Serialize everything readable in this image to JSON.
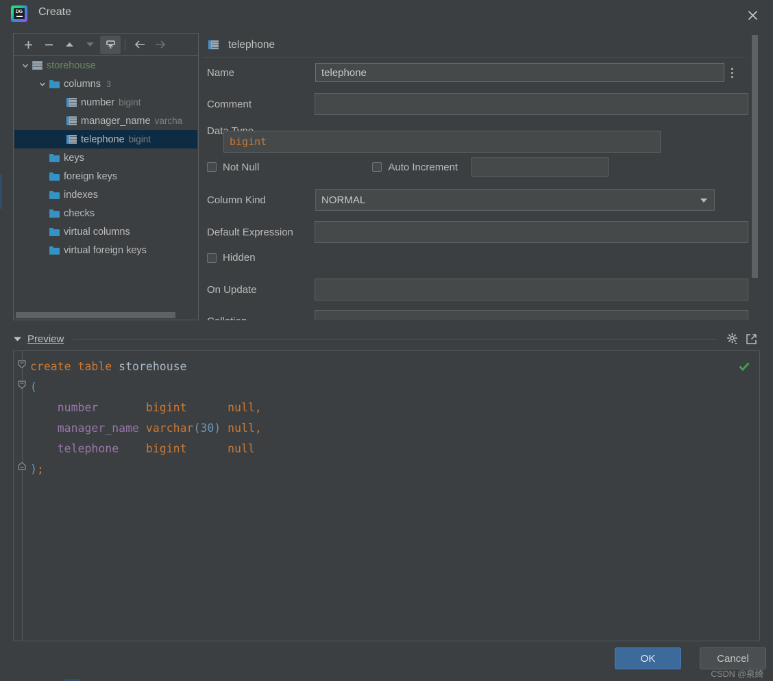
{
  "window": {
    "title": "Create",
    "logo_icon": "datagrip-logo-icon",
    "close_icon": "close-icon"
  },
  "tree_toolbar": {
    "buttons": [
      {
        "name": "add-button",
        "icon": "plus-icon",
        "enabled": true,
        "active": false
      },
      {
        "name": "remove-button",
        "icon": "minus-icon",
        "enabled": true,
        "active": false
      },
      {
        "name": "move-up-button",
        "icon": "arrow-up-icon",
        "enabled": true,
        "active": false
      },
      {
        "name": "move-down-button",
        "icon": "arrow-down-icon",
        "enabled": false,
        "active": false
      },
      {
        "name": "move-into-button",
        "icon": "upload-into-icon",
        "enabled": true,
        "active": true
      },
      {
        "name": "navigate-back-button",
        "icon": "arrow-left-icon",
        "enabled": true,
        "active": false
      },
      {
        "name": "navigate-forward-button",
        "icon": "arrow-right-icon",
        "enabled": false,
        "active": false
      }
    ]
  },
  "tree": {
    "rows": [
      {
        "label": "storehouse",
        "sub": "",
        "count": "",
        "icon": "table-icon",
        "indent": 0,
        "twisty": "expanded",
        "selected": false,
        "label_color": "green"
      },
      {
        "label": "columns",
        "sub": "",
        "count": "3",
        "icon": "folder-icon",
        "indent": 1,
        "twisty": "expanded",
        "selected": false,
        "label_color": "normal"
      },
      {
        "label": "number",
        "sub": "bigint",
        "count": "",
        "icon": "column-icon",
        "indent": 2,
        "twisty": "none",
        "selected": false,
        "label_color": "normal"
      },
      {
        "label": "manager_name",
        "sub": "varcha",
        "count": "",
        "icon": "column-icon",
        "indent": 2,
        "twisty": "none",
        "selected": false,
        "label_color": "normal"
      },
      {
        "label": "telephone",
        "sub": "bigint",
        "count": "",
        "icon": "column-icon",
        "indent": 2,
        "twisty": "none",
        "selected": true,
        "label_color": "normal"
      },
      {
        "label": "keys",
        "sub": "",
        "count": "",
        "icon": "folder-icon",
        "indent": 1,
        "twisty": "none",
        "selected": false,
        "label_color": "normal"
      },
      {
        "label": "foreign keys",
        "sub": "",
        "count": "",
        "icon": "folder-icon",
        "indent": 1,
        "twisty": "none",
        "selected": false,
        "label_color": "normal"
      },
      {
        "label": "indexes",
        "sub": "",
        "count": "",
        "icon": "folder-icon",
        "indent": 1,
        "twisty": "none",
        "selected": false,
        "label_color": "normal"
      },
      {
        "label": "checks",
        "sub": "",
        "count": "",
        "icon": "folder-icon",
        "indent": 1,
        "twisty": "none",
        "selected": false,
        "label_color": "normal"
      },
      {
        "label": "virtual columns",
        "sub": "",
        "count": "",
        "icon": "folder-icon",
        "indent": 1,
        "twisty": "none",
        "selected": false,
        "label_color": "normal"
      },
      {
        "label": "virtual foreign keys",
        "sub": "",
        "count": "",
        "icon": "folder-icon",
        "indent": 1,
        "twisty": "none",
        "selected": false,
        "label_color": "normal"
      }
    ]
  },
  "form": {
    "header_title": "telephone",
    "header_icon": "column-icon",
    "name": {
      "label": "Name",
      "value": "telephone",
      "placeholder": ""
    },
    "comment": {
      "label": "Comment",
      "value": "",
      "placeholder": "",
      "expand_icon": "expand-diagonal-icon"
    },
    "data_type": {
      "label": "Data Type",
      "value": "bigint",
      "placeholder": "",
      "chevron_down_icon": "chevron-down-icon",
      "chevron_right_icon": "chevron-right-icon"
    },
    "not_null": {
      "label": "Not Null",
      "checked": false
    },
    "auto_increment": {
      "label": "Auto Increment",
      "checked": false,
      "value": "",
      "placeholder": ""
    },
    "column_kind": {
      "label": "Column Kind",
      "value": "NORMAL",
      "options": [
        "NORMAL"
      ],
      "caret_icon": "triangle-down-icon"
    },
    "default_expression": {
      "label": "Default Expression",
      "value": "",
      "placeholder": "",
      "chevron_down_icon": "chevron-down-icon",
      "chevron_right_icon": "chevron-right-icon"
    },
    "hidden": {
      "label": "Hidden",
      "checked": false
    },
    "on_update": {
      "label": "On Update",
      "value": "",
      "placeholder": ""
    },
    "collation": {
      "label": "Collation",
      "value": "",
      "placeholder": "",
      "chevron_down_icon": "chevron-down-icon"
    },
    "kebab_icon": "more-options-icon"
  },
  "preview": {
    "title": "Preview",
    "collapse_icon": "triangle-down-icon",
    "settings_icon": "gear-icon",
    "open_external_icon": "external-link-icon",
    "valid_icon": "green-check-icon",
    "sql_lines": [
      [
        {
          "t": "create",
          "c": "kw"
        },
        {
          "t": " ",
          "c": "tbl"
        },
        {
          "t": "table",
          "c": "kw"
        },
        {
          "t": " ",
          "c": "tbl"
        },
        {
          "t": "storehouse",
          "c": "tbl"
        }
      ],
      [
        {
          "t": "(",
          "c": "pn"
        }
      ],
      [
        {
          "t": "    ",
          "c": "tbl"
        },
        {
          "t": "number",
          "c": "id"
        },
        {
          "t": "       ",
          "c": "tbl"
        },
        {
          "t": "bigint",
          "c": "kw"
        },
        {
          "t": "      ",
          "c": "tbl"
        },
        {
          "t": "null",
          "c": "kw"
        },
        {
          "t": ",",
          "c": "kw"
        }
      ],
      [
        {
          "t": "    ",
          "c": "tbl"
        },
        {
          "t": "manager_name",
          "c": "id"
        },
        {
          "t": " ",
          "c": "tbl"
        },
        {
          "t": "varchar",
          "c": "kw"
        },
        {
          "t": "(",
          "c": "pn"
        },
        {
          "t": "30",
          "c": "num"
        },
        {
          "t": ")",
          "c": "pn"
        },
        {
          "t": " ",
          "c": "tbl"
        },
        {
          "t": "null",
          "c": "kw"
        },
        {
          "t": ",",
          "c": "kw"
        }
      ],
      [
        {
          "t": "    ",
          "c": "tbl"
        },
        {
          "t": "telephone",
          "c": "id"
        },
        {
          "t": "    ",
          "c": "tbl"
        },
        {
          "t": "bigint",
          "c": "kw"
        },
        {
          "t": "      ",
          "c": "tbl"
        },
        {
          "t": "null",
          "c": "kw"
        }
      ],
      [
        {
          "t": ")",
          "c": "pn"
        },
        {
          "t": ";",
          "c": "kw"
        }
      ]
    ]
  },
  "footer": {
    "ok_label": "OK",
    "cancel_label": "Cancel",
    "watermark": "CSDN @泉绮"
  },
  "colors": {
    "window_bg": "#3c3f41",
    "selection_bg": "#0d2b42",
    "accent_blue": "#3c6a9b",
    "folder_blue": "#3592c4",
    "table_green": "#6a8759",
    "keyword_orange": "#cc7832",
    "identifier_purple": "#9876aa",
    "number_blue": "#6897bb",
    "success_green": "#499c54"
  }
}
